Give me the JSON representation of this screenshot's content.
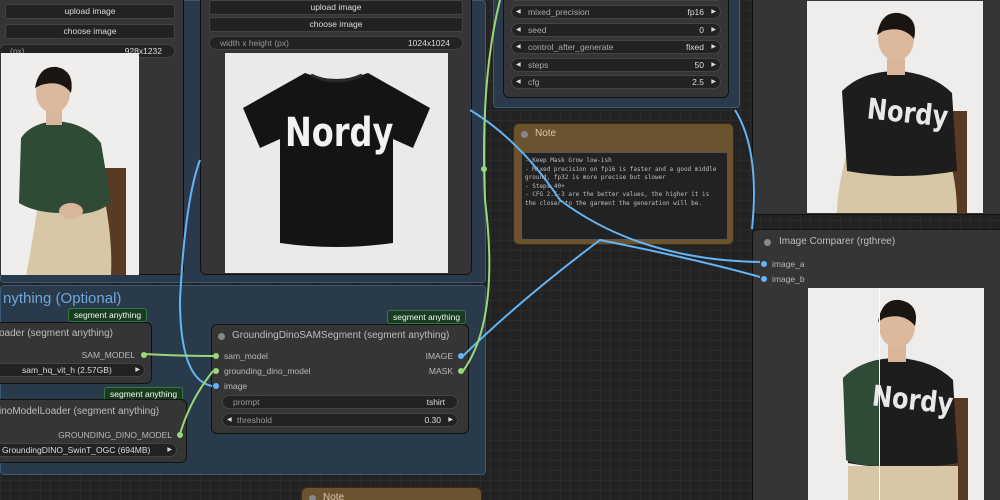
{
  "groups": {
    "segment": {
      "title": "nything (Optional)"
    }
  },
  "left_loader": {
    "upload_label": "upload image",
    "choose_label": "choose image",
    "size_label": "(px)",
    "size_value": "928x1232"
  },
  "center_loader": {
    "upload_label": "upload image",
    "choose_label": "choose image",
    "size_label": "width x height (px)",
    "size_value": "1024x1024",
    "tshirt_text": "Nordy"
  },
  "sampler": {
    "rows": [
      {
        "label": "mixed_precision",
        "value": "fp16"
      },
      {
        "label": "seed",
        "value": "0"
      },
      {
        "label": "control_after_generate",
        "value": "fixed"
      },
      {
        "label": "steps",
        "value": "50"
      },
      {
        "label": "cfg",
        "value": "2.5"
      }
    ]
  },
  "note": {
    "title": "Note",
    "lines": [
      "- Keep Mask Grow low-ish",
      "- Mixed precision on fp16 is faster and a good middle",
      "ground, fp32 is more precise but slower",
      "- Steps 40+",
      "- CFG 2.5-3 are the better values, the higher it is",
      "the closer to the garment the generation will be."
    ]
  },
  "note_bottom": {
    "title": "Note"
  },
  "sam_loader": {
    "tag": "segment anything",
    "title": "oader (segment anything)",
    "output": "SAM_MODEL",
    "model_value": "sam_hq_vit_h (2.57GB)"
  },
  "dino_loader": {
    "tag": "segment anything",
    "title": "inoModelLoader (segment anything)",
    "output": "GROUNDING_DINO_MODEL",
    "model_value": "GroundingDINO_SwinT_OGC (694MB)"
  },
  "grounding_node": {
    "tag": "segment anything",
    "title": "GroundingDinoSAMSegment (segment anything)",
    "inputs": [
      "sam_model",
      "grounding_dino_model",
      "image"
    ],
    "outputs": [
      "IMAGE",
      "MASK"
    ],
    "prompt_label": "prompt",
    "prompt_value": "tshirt",
    "threshold_label": "threshold",
    "threshold_value": "0.30"
  },
  "comparer": {
    "title": "Image Comparer (rgthree)",
    "inputs": [
      "image_a",
      "image_b"
    ],
    "tshirt_text": "Nordy"
  },
  "result_preview": {
    "tshirt_text": "Nordy"
  },
  "colors": {
    "bg": "#222222",
    "node": "#353535",
    "note": "#6b5330",
    "group": "#2a3b4c",
    "tag": "#1a3a22",
    "image_link": "#64b5f6",
    "model_link": "#9ad67a"
  }
}
